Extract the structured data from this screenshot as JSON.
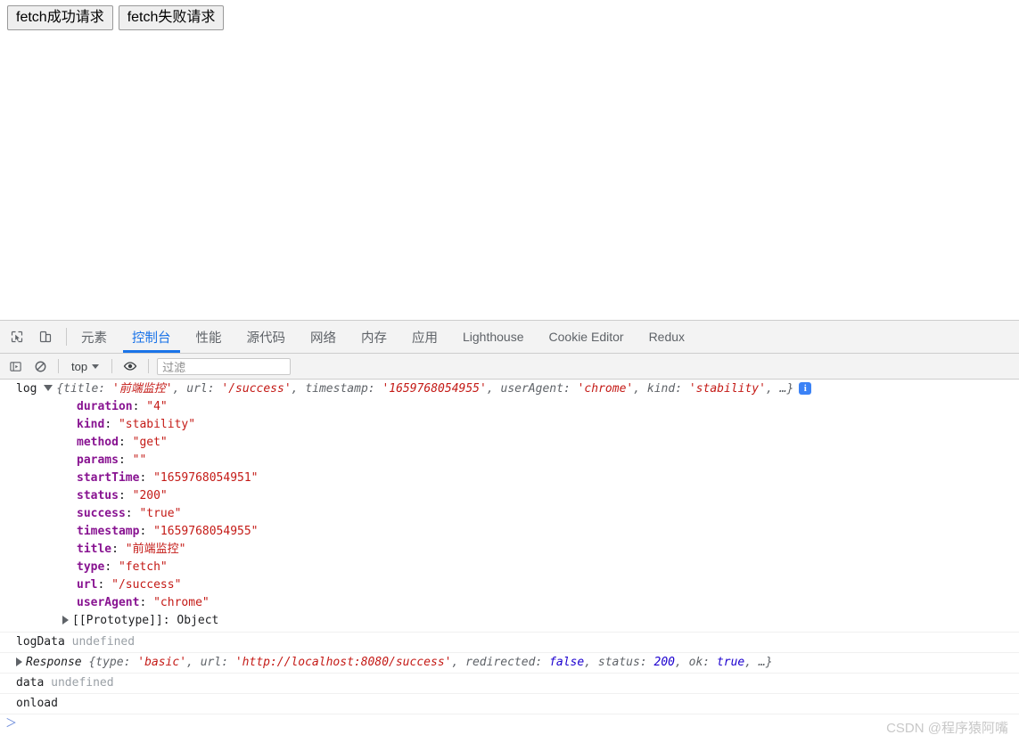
{
  "page": {
    "buttons": [
      {
        "label": "fetch成功请求",
        "name": "fetch-success-button"
      },
      {
        "label": "fetch失败请求",
        "name": "fetch-failure-button"
      }
    ]
  },
  "devtools": {
    "toolbar_icons": [
      {
        "name": "inspect-element-icon",
        "title": "检查元素"
      },
      {
        "name": "device-toolbar-icon",
        "title": "设备工具栏"
      }
    ],
    "tabs": [
      {
        "label": "元素",
        "active": false,
        "latin": false
      },
      {
        "label": "控制台",
        "active": true,
        "latin": false
      },
      {
        "label": "性能",
        "active": false,
        "latin": false
      },
      {
        "label": "源代码",
        "active": false,
        "latin": false
      },
      {
        "label": "网络",
        "active": false,
        "latin": false
      },
      {
        "label": "内存",
        "active": false,
        "latin": false
      },
      {
        "label": "应用",
        "active": false,
        "latin": false
      },
      {
        "label": "Lighthouse",
        "active": false,
        "latin": true
      },
      {
        "label": "Cookie Editor",
        "active": false,
        "latin": true
      },
      {
        "label": "Redux",
        "active": false,
        "latin": true
      }
    ],
    "console_toolbar": {
      "sidebar_toggle": "sidebar-toggle-icon",
      "clear_console": "clear-console-icon",
      "context": "top",
      "eye": "eye-icon",
      "filter_placeholder": "过滤"
    },
    "accent_color": "#1a73e8"
  },
  "console": {
    "messages": [
      {
        "kind": "object-expanded",
        "label": "log",
        "preview": {
          "open": "{",
          "entries": [
            {
              "key": "title",
              "value": "'前端监控'",
              "type": "string"
            },
            {
              "key": "url",
              "value": "'/success'",
              "type": "string"
            },
            {
              "key": "timestamp",
              "value": "'1659768054955'",
              "type": "string"
            },
            {
              "key": "userAgent",
              "value": "'chrome'",
              "type": "string"
            },
            {
              "key": "kind",
              "value": "'stability'",
              "type": "string"
            }
          ],
          "ellipsis": "…",
          "close": "}"
        },
        "badge": "i",
        "props": [
          {
            "key": "duration",
            "value": "\"4\"",
            "type": "string"
          },
          {
            "key": "kind",
            "value": "\"stability\"",
            "type": "string"
          },
          {
            "key": "method",
            "value": "\"get\"",
            "type": "string"
          },
          {
            "key": "params",
            "value": "\"\"",
            "type": "string"
          },
          {
            "key": "startTime",
            "value": "\"1659768054951\"",
            "type": "string"
          },
          {
            "key": "status",
            "value": "\"200\"",
            "type": "string"
          },
          {
            "key": "success",
            "value": "\"true\"",
            "type": "string"
          },
          {
            "key": "timestamp",
            "value": "\"1659768054955\"",
            "type": "string"
          },
          {
            "key": "title",
            "value": "\"前端监控\"",
            "type": "string"
          },
          {
            "key": "type",
            "value": "\"fetch\"",
            "type": "string"
          },
          {
            "key": "url",
            "value": "\"/success\"",
            "type": "string"
          },
          {
            "key": "userAgent",
            "value": "\"chrome\"",
            "type": "string"
          }
        ],
        "prototype": {
          "key": "[[Prototype]]",
          "value": "Object"
        }
      },
      {
        "kind": "simple",
        "label": "logData",
        "value": "undefined"
      },
      {
        "kind": "object-collapsed",
        "constructor": "Response",
        "preview": {
          "open": "{",
          "entries": [
            {
              "key": "type",
              "value": "'basic'",
              "type": "string"
            },
            {
              "key": "url",
              "value": "'http://localhost:8080/success'",
              "type": "string"
            },
            {
              "key": "redirected",
              "value": "false",
              "type": "bool"
            },
            {
              "key": "status",
              "value": "200",
              "type": "number"
            },
            {
              "key": "ok",
              "value": "true",
              "type": "bool"
            }
          ],
          "ellipsis": "…",
          "close": "}"
        }
      },
      {
        "kind": "simple",
        "label": "data",
        "value": "undefined"
      },
      {
        "kind": "plain",
        "label": "onload"
      }
    ],
    "prompt_symbol": "＞"
  },
  "watermark": {
    "text": "CSDN @程序猿阿嘴"
  }
}
